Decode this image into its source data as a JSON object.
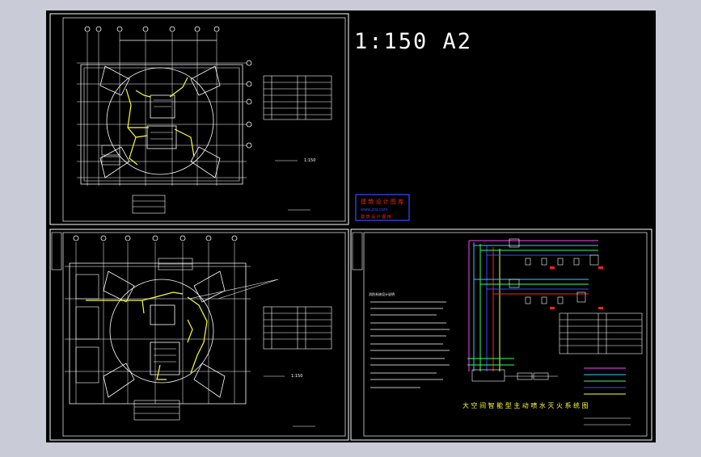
{
  "window": {
    "background": "#c9ccd6",
    "canvas_background": "#000000"
  },
  "colors": {
    "yellow": "#ffff33",
    "red": "#ff2020",
    "blue": "#3a4cff",
    "green": "#33ff66",
    "magenta": "#ff44ff",
    "cyan": "#33ccff"
  },
  "drawing": {
    "scale_title": "1:150  A2",
    "plan_top_scale": "1:150",
    "plan_bottom_scale": "1:150",
    "stamp": {
      "line1": "建 筑 设 计 图 库",
      "line2": "www.jzsj.com",
      "line3": "建 筑 设 计 图 库"
    },
    "system_title": "大 空 间 智 能 型 主 动 喷 水 灭 火 系 统 图",
    "notes_title": "消防系统设计说明"
  },
  "icons": {
    "stamp": "stamp-icon"
  }
}
